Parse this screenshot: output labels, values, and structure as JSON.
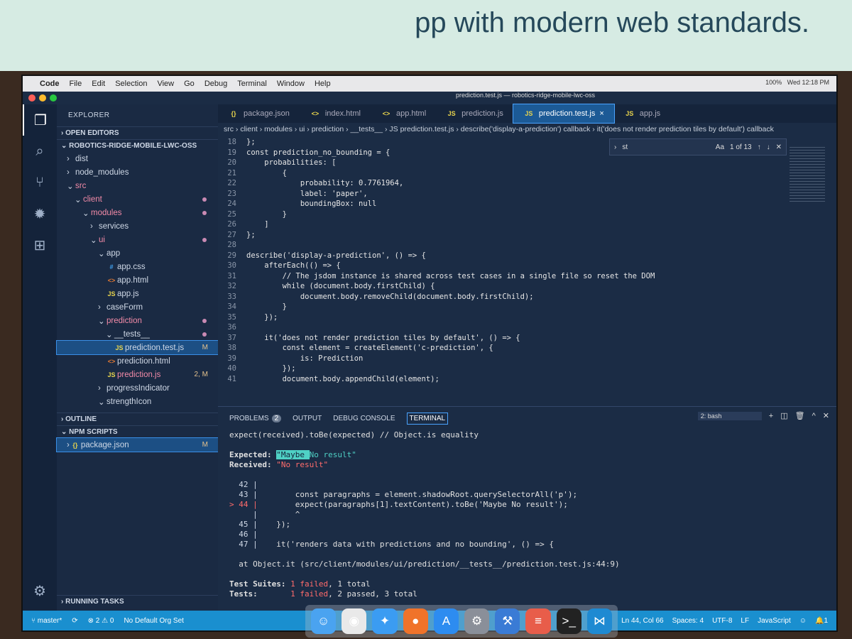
{
  "banner": "pp with modern web standards.",
  "menubar": {
    "app": "Code",
    "items": [
      "File",
      "Edit",
      "Selection",
      "View",
      "Go",
      "Debug",
      "Terminal",
      "Window",
      "Help"
    ],
    "battery": "100%",
    "clock": "Wed 12:18 PM"
  },
  "window_title": "prediction.test.js — robotics-ridge-mobile-lwc-oss",
  "explorer": {
    "title": "EXPLORER",
    "open_editors": "OPEN EDITORS",
    "project": "ROBOTICS-RIDGE-MOBILE-LWC-OSS",
    "tree": [
      {
        "label": "dist",
        "depth": 0,
        "type": "folder",
        "open": false
      },
      {
        "label": "node_modules",
        "depth": 0,
        "type": "folder",
        "open": false
      },
      {
        "label": "src",
        "depth": 0,
        "type": "folder",
        "open": true,
        "color": "#f38ba8"
      },
      {
        "label": "client",
        "depth": 1,
        "type": "folder",
        "open": true,
        "color": "#f38ba8",
        "dot": true
      },
      {
        "label": "modules",
        "depth": 2,
        "type": "folder",
        "open": true,
        "color": "#f38ba8",
        "dot": true
      },
      {
        "label": "services",
        "depth": 3,
        "type": "folder",
        "open": false
      },
      {
        "label": "ui",
        "depth": 3,
        "type": "folder",
        "open": true,
        "color": "#f38ba8",
        "dot": true
      },
      {
        "label": "app",
        "depth": 4,
        "type": "folder",
        "open": true
      },
      {
        "label": "app.css",
        "depth": 5,
        "type": "file",
        "icon": "#"
      },
      {
        "label": "app.html",
        "depth": 5,
        "type": "file",
        "icon": "<>"
      },
      {
        "label": "app.js",
        "depth": 5,
        "type": "file",
        "icon": "JS"
      },
      {
        "label": "caseForm",
        "depth": 4,
        "type": "folder",
        "open": false
      },
      {
        "label": "prediction",
        "depth": 4,
        "type": "folder",
        "open": true,
        "color": "#f38ba8",
        "dot": true
      },
      {
        "label": "__tests__",
        "depth": 5,
        "type": "folder",
        "open": true,
        "dot": true
      },
      {
        "label": "prediction.test.js",
        "depth": 6,
        "type": "file",
        "icon": "JS",
        "badge": "M",
        "selected": true
      },
      {
        "label": "prediction.html",
        "depth": 5,
        "type": "file",
        "icon": "<>"
      },
      {
        "label": "prediction.js",
        "depth": 5,
        "type": "file",
        "icon": "JS",
        "badge": "2, M",
        "color": "#f38ba8"
      },
      {
        "label": "progressIndicator",
        "depth": 4,
        "type": "folder",
        "open": false
      },
      {
        "label": "strengthIcon",
        "depth": 4,
        "type": "folder",
        "open": true
      }
    ],
    "outline": "OUTLINE",
    "npm_scripts": "NPM SCRIPTS",
    "npm_item": "package.json",
    "npm_badge": "M",
    "running_tasks": "RUNNING TASKS"
  },
  "tabs": [
    {
      "label": "package.json",
      "icon": "{}"
    },
    {
      "label": "index.html",
      "icon": "<>"
    },
    {
      "label": "app.html",
      "icon": "<>"
    },
    {
      "label": "prediction.js",
      "icon": "JS"
    },
    {
      "label": "prediction.test.js",
      "icon": "JS",
      "active": true
    },
    {
      "label": "app.js",
      "icon": "JS"
    }
  ],
  "breadcrumbs": "src › client › modules › ui › prediction › __tests__ › JS prediction.test.js › describe('display-a-prediction') callback › it('does not render prediction tiles by default') callback",
  "find": {
    "value": "st",
    "count": "1 of 13",
    "case": "Aa"
  },
  "code": [
    {
      "n": "18",
      "t": "};"
    },
    {
      "n": "19",
      "t": "const prediction_no_bounding = {"
    },
    {
      "n": "20",
      "t": "    probabilities: ["
    },
    {
      "n": "21",
      "t": "        {"
    },
    {
      "n": "22",
      "t": "            probability: 0.7761964,"
    },
    {
      "n": "23",
      "t": "            label: 'paper',"
    },
    {
      "n": "24",
      "t": "            boundingBox: null"
    },
    {
      "n": "25",
      "t": "        }"
    },
    {
      "n": "26",
      "t": "    ]"
    },
    {
      "n": "27",
      "t": "};"
    },
    {
      "n": "28",
      "t": ""
    },
    {
      "n": "29",
      "t": "describe('display-a-prediction', () => {"
    },
    {
      "n": "30",
      "t": "    afterEach(() => {"
    },
    {
      "n": "31",
      "t": "        // The jsdom instance is shared across test cases in a single file so reset the DOM"
    },
    {
      "n": "32",
      "t": "        while (document.body.firstChild) {"
    },
    {
      "n": "33",
      "t": "            document.body.removeChild(document.body.firstChild);"
    },
    {
      "n": "34",
      "t": "        }"
    },
    {
      "n": "35",
      "t": "    });"
    },
    {
      "n": "36",
      "t": ""
    },
    {
      "n": "37",
      "t": "    it('does not render prediction tiles by default', () => {"
    },
    {
      "n": "38",
      "t": "        const element = createElement('c-prediction', {"
    },
    {
      "n": "39",
      "t": "            is: Prediction"
    },
    {
      "n": "40",
      "t": "        });"
    },
    {
      "n": "41",
      "t": "        document.body.appendChild(element);"
    }
  ],
  "panel": {
    "tabs": [
      "PROBLEMS",
      "OUTPUT",
      "DEBUG CONSOLE",
      "TERMINAL"
    ],
    "problems_count": "2",
    "shell": "2: bash"
  },
  "terminal": {
    "l1": "expect(received).toBe(expected) // Object.is equality",
    "expected_label": "Expected: ",
    "expected_hl": "\"Maybe ",
    "expected_rest": "No result\"",
    "received_label": "Received: ",
    "received_val": "\"No result\"",
    "snippet": [
      {
        "n": "  42 |",
        "t": ""
      },
      {
        "n": "  43 |",
        "t": "        const paragraphs = element.shadowRoot.querySelectorAll('p');"
      },
      {
        "n": "> 44 |",
        "t": "        expect(paragraphs[1].textContent).toBe('Maybe No result');"
      },
      {
        "n": "     |",
        "t": "        ^"
      },
      {
        "n": "  45 |",
        "t": "    });"
      },
      {
        "n": "  46 |",
        "t": ""
      },
      {
        "n": "  47 |",
        "t": "    it('renders data with predictions and no bounding', () => {"
      }
    ],
    "at": "at Object.it (src/client/modules/ui/prediction/__tests__/prediction.test.js:44:9)",
    "suites_label": "Test Suites: ",
    "suites_fail": "1 failed",
    "suites_rest": ", 1 total",
    "tests_label": "Tests:       ",
    "tests_fail": "1 failed",
    "tests_rest": ", 2 passed, 3 total"
  },
  "status": {
    "branch": "master*",
    "errors": "⊗ 2 ⚠ 0",
    "org": "No Default Org Set",
    "position": "Ln 44, Col 66",
    "spaces": "Spaces: 4",
    "encoding": "UTF-8",
    "eol": "LF",
    "language": "JavaScript",
    "notifications": "1"
  },
  "dock": [
    "finder",
    "chrome",
    "safari",
    "firefox",
    "app-store",
    "system-preferences",
    "xcode",
    "messages",
    "terminal",
    "vscode"
  ],
  "colors": {
    "status_bar": "#1a8fcf",
    "editor_bg": "#1b2c45",
    "accent": "#4aa3ff"
  }
}
